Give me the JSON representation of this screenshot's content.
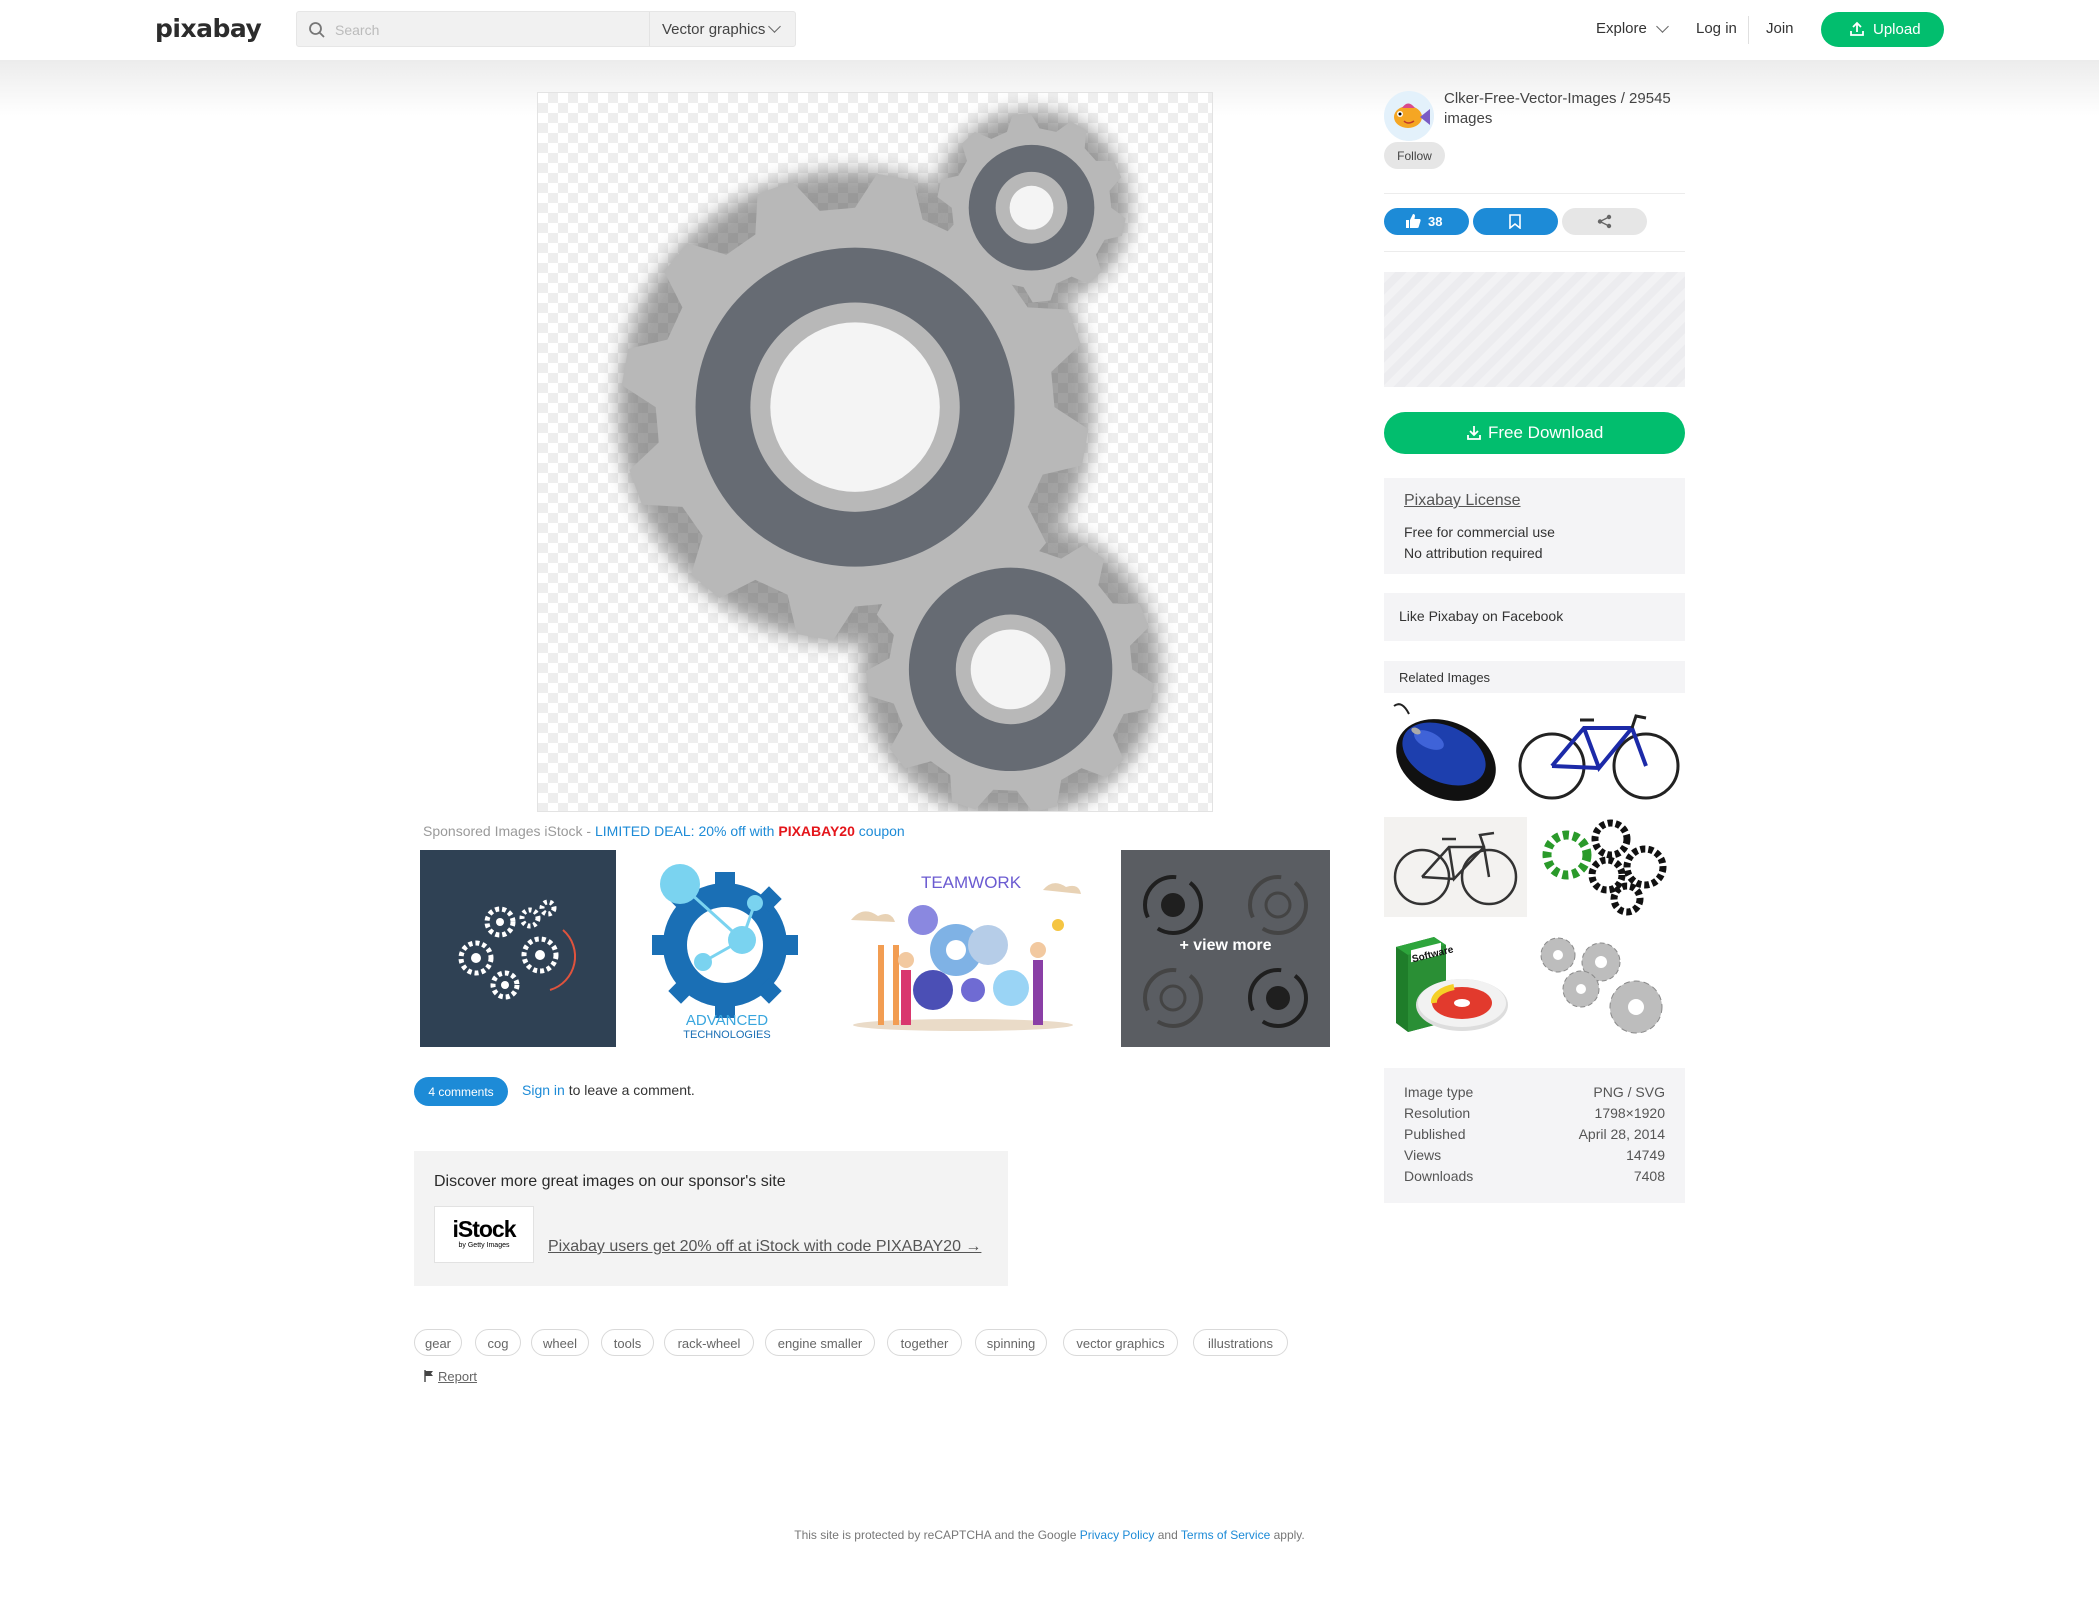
{
  "header": {
    "logo": "pixabay",
    "search_placeholder": "Search",
    "search_type": "Vector graphics",
    "explore": "Explore",
    "login": "Log in",
    "join": "Join",
    "upload": "Upload"
  },
  "sponsored": {
    "prefix": "Sponsored Images iStock - ",
    "deal": "LIMITED DEAL: 20% off with ",
    "code": "PIXABAY20",
    "suffix": " coupon",
    "view_more": "+ view more",
    "thumb_teamwork_text": "TEAMWORK",
    "thumb_advanced_line1": "ADVANCED",
    "thumb_advanced_line2": "TECHNOLOGIES"
  },
  "comments": {
    "count_label": "4 comments",
    "signin": "Sign in",
    "signin_suffix": " to leave a comment."
  },
  "sponsor_box": {
    "title": "Discover more great images on our sponsor's site",
    "logo_name": "iStock",
    "logo_sub": "by Getty Images",
    "link": "Pixabay users get 20% off at iStock with code PIXABAY20 →"
  },
  "tags": [
    "gear",
    "cog",
    "wheel",
    "tools",
    "rack-wheel",
    "engine smaller",
    "together",
    "spinning",
    "vector graphics",
    "illustrations"
  ],
  "report": "Report",
  "footer": {
    "prefix": "This site is protected by reCAPTCHA and the Google ",
    "privacy": "Privacy Policy",
    "and": " and ",
    "terms": "Terms of Service",
    "suffix": " apply."
  },
  "sidebar": {
    "author": "Clker-Free-Vector-Images / 29545 images",
    "follow": "Follow",
    "likes": "38",
    "download": "Free Download",
    "license_title": "Pixabay License",
    "license_line1": "Free for commercial use",
    "license_line2": "No attribution required",
    "facebook": "Like Pixabay on Facebook",
    "related_title": "Related Images",
    "related_software_text": "Software",
    "meta": [
      {
        "label": "Image type",
        "value": "PNG / SVG"
      },
      {
        "label": "Resolution",
        "value": "1798×1920"
      },
      {
        "label": "Published",
        "value": "April 28, 2014"
      },
      {
        "label": "Views",
        "value": "14749"
      },
      {
        "label": "Downloads",
        "value": "7408"
      }
    ]
  },
  "colors": {
    "brand_green": "#02be6e",
    "link_blue": "#1d8bd7",
    "coupon_red": "#e4161b",
    "gear_light": "#b8b8b8",
    "gear_dark": "#666b73"
  }
}
